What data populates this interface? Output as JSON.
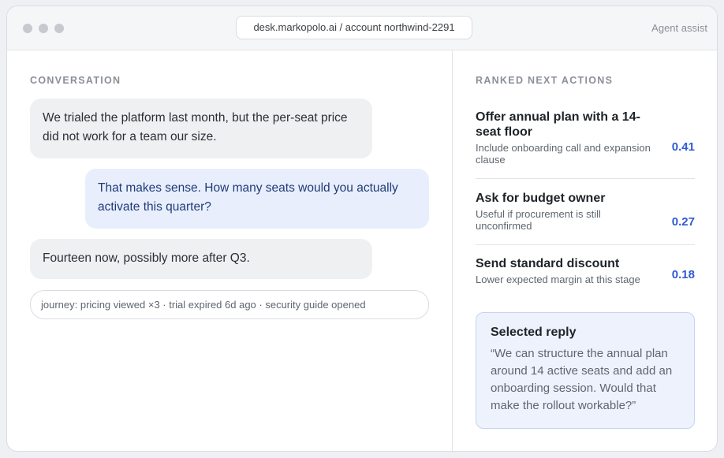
{
  "window": {
    "url": "desk.markopolo.ai / account northwind-2291",
    "agent_assist_label": "Agent assist"
  },
  "conversation": {
    "label": "CONVERSATION",
    "messages": [
      {
        "direction": "inbound",
        "text": "We trialed the platform last month, but the per-seat price did not work for a team our size."
      },
      {
        "direction": "outbound",
        "text": "That makes sense. How many seats would you actually activate this quarter?"
      },
      {
        "direction": "inbound",
        "text": "Fourteen now, possibly more after Q3."
      }
    ],
    "journey": "journey: pricing viewed ×3 · trial expired 6d ago · security guide opened"
  },
  "next_actions": {
    "label": "RANKED NEXT ACTIONS",
    "items": [
      {
        "title": "Offer annual plan with a 14-seat floor",
        "subtitle": "Include onboarding call and expansion clause",
        "score": "0.41"
      },
      {
        "title": "Ask for budget owner",
        "subtitle": "Useful if procurement is still unconfirmed",
        "score": "0.27"
      },
      {
        "title": "Send standard discount",
        "subtitle": "Lower expected margin at this stage",
        "score": "0.18"
      }
    ]
  },
  "selected_reply": {
    "title": "Selected reply",
    "text": "“We can structure the annual plan around 14 active seats and add an onboarding session. Would that make the rollout workable?”"
  },
  "colors": {
    "accent": "#2f5bd3",
    "outbound_bubble": "#e8eefc",
    "inbound_bubble": "#eff0f2"
  }
}
